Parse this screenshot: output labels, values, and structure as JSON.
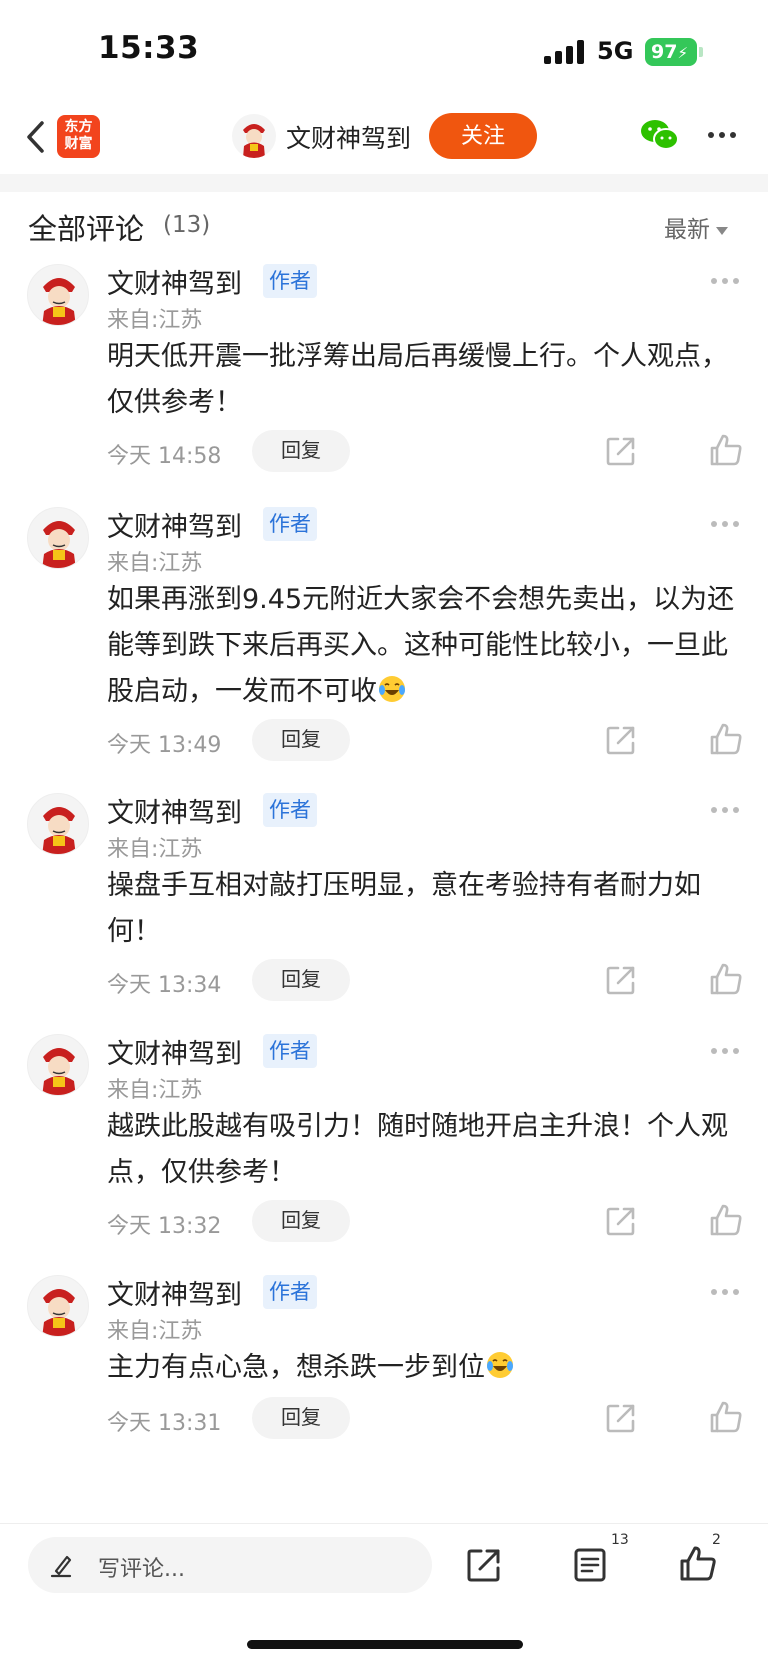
{
  "status_bar": {
    "time": "15:33",
    "network": "5G",
    "battery": "97"
  },
  "nav": {
    "logo_line1": "东方",
    "logo_line2": "财富",
    "title": "文财神驾到",
    "follow_label": "关注",
    "brand_color": "#f0560f"
  },
  "section": {
    "title": "全部评论",
    "count": "(13)",
    "sort_label": "最新"
  },
  "comments": [
    {
      "author": "文财神驾到",
      "badge": "作者",
      "origin": "来自:江苏",
      "text": "明天低开震一批浮筹出局后再缓慢上行。个人观点，仅供参考！",
      "has_emoji": false,
      "time": "今天 14:58",
      "reply_label": "回复"
    },
    {
      "author": "文财神驾到",
      "badge": "作者",
      "origin": "来自:江苏",
      "text": "如果再涨到9.45元附近大家会不会想先卖出，以为还能等到跌下来后再买入。这种可能性比较小，一旦此股启动，一发而不可收",
      "has_emoji": true,
      "time": "今天 13:49",
      "reply_label": "回复"
    },
    {
      "author": "文财神驾到",
      "badge": "作者",
      "origin": "来自:江苏",
      "text": "操盘手互相对敲打压明显，意在考验持有者耐力如何！",
      "has_emoji": false,
      "time": "今天 13:34",
      "reply_label": "回复"
    },
    {
      "author": "文财神驾到",
      "badge": "作者",
      "origin": "来自:江苏",
      "text": "越跌此股越有吸引力！随时随地开启主升浪！个人观点，仅供参考！",
      "has_emoji": false,
      "time": "今天 13:32",
      "reply_label": "回复"
    },
    {
      "author": "文财神驾到",
      "badge": "作者",
      "origin": "来自:江苏",
      "text": "主力有点心急，想杀跌一步到位",
      "has_emoji": true,
      "time": "今天 13:31",
      "reply_label": "回复"
    }
  ],
  "bottom_bar": {
    "input_placeholder": "写评论...",
    "comments_count": "13",
    "likes_count": "2"
  },
  "icons": {
    "back": "chevron-left-icon",
    "wechat": "wechat-icon",
    "more": "more-dots-icon",
    "share": "share-icon",
    "like": "thumbs-up-icon",
    "pen": "pen-icon",
    "comment_list": "comment-list-icon",
    "emoji": "laughing-tears-emoji"
  }
}
